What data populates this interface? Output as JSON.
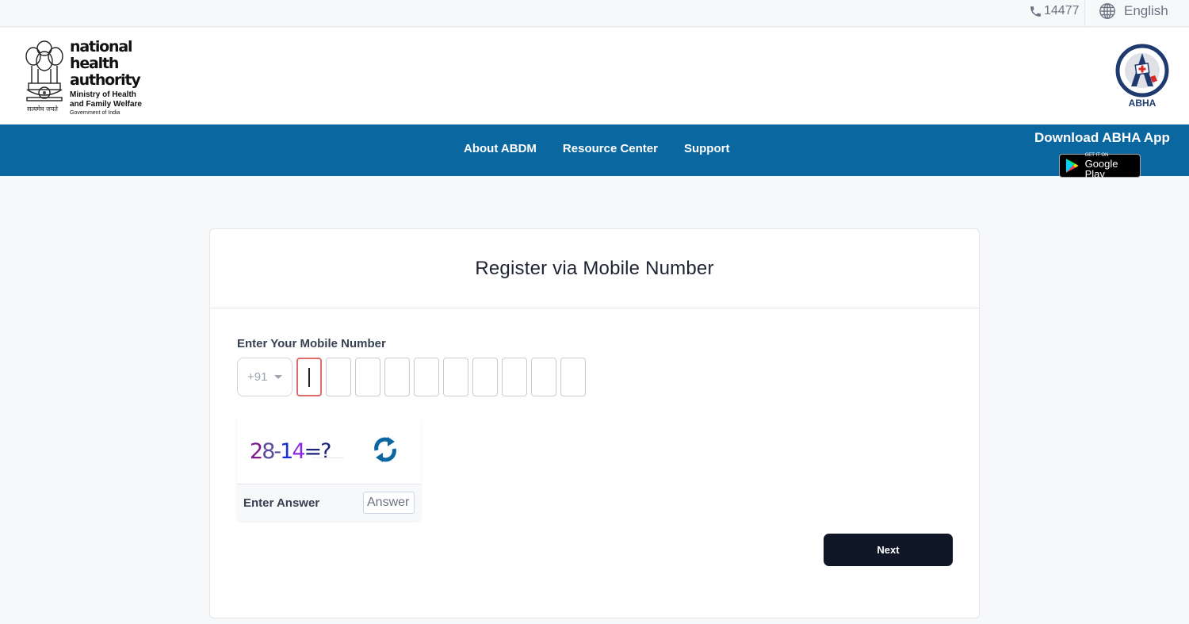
{
  "topbar": {
    "helpline_icon": "phone-icon",
    "helpline_number": "14477",
    "language_icon": "globe-icon",
    "language": "English"
  },
  "header": {
    "nha_logo": {
      "title_line1": "national",
      "title_line2": "health",
      "title_line3": "authority",
      "ministry_line1": "Ministry of Health",
      "ministry_line2": "and Family Welfare",
      "government": "Government of India",
      "emblem_caption": "सत्यमेव जयते"
    },
    "abha_logo": {
      "label": "ABHA"
    }
  },
  "navbar": {
    "links": [
      {
        "label": "About ABDM"
      },
      {
        "label": "Resource Center"
      },
      {
        "label": "Support"
      }
    ],
    "download": {
      "title": "Download ABHA App",
      "store_small": "GET IT ON",
      "store_big": "Google Play"
    }
  },
  "form": {
    "title": "Register via Mobile Number",
    "mobile_label": "Enter Your Mobile Number",
    "country_code": "+91",
    "digit_count": 10,
    "digits": [
      "",
      "",
      "",
      "",
      "",
      "",
      "",
      "",
      "",
      ""
    ],
    "captcha": {
      "expression_parts": [
        "2",
        "8",
        "-",
        "1",
        "4",
        "=?"
      ],
      "expression": "28-14=?",
      "refresh_icon": "refresh-icon",
      "answer_label": "Enter Answer",
      "answer_placeholder": "Answer",
      "answer_value": ""
    },
    "next_label": "Next"
  },
  "colors": {
    "nav_blue": "#0b67a0",
    "button_dark": "#101727",
    "active_digit_border": "#e06b6b",
    "abha_navy": "#1e3a6e",
    "refresh_blue": "#0b67a0"
  }
}
